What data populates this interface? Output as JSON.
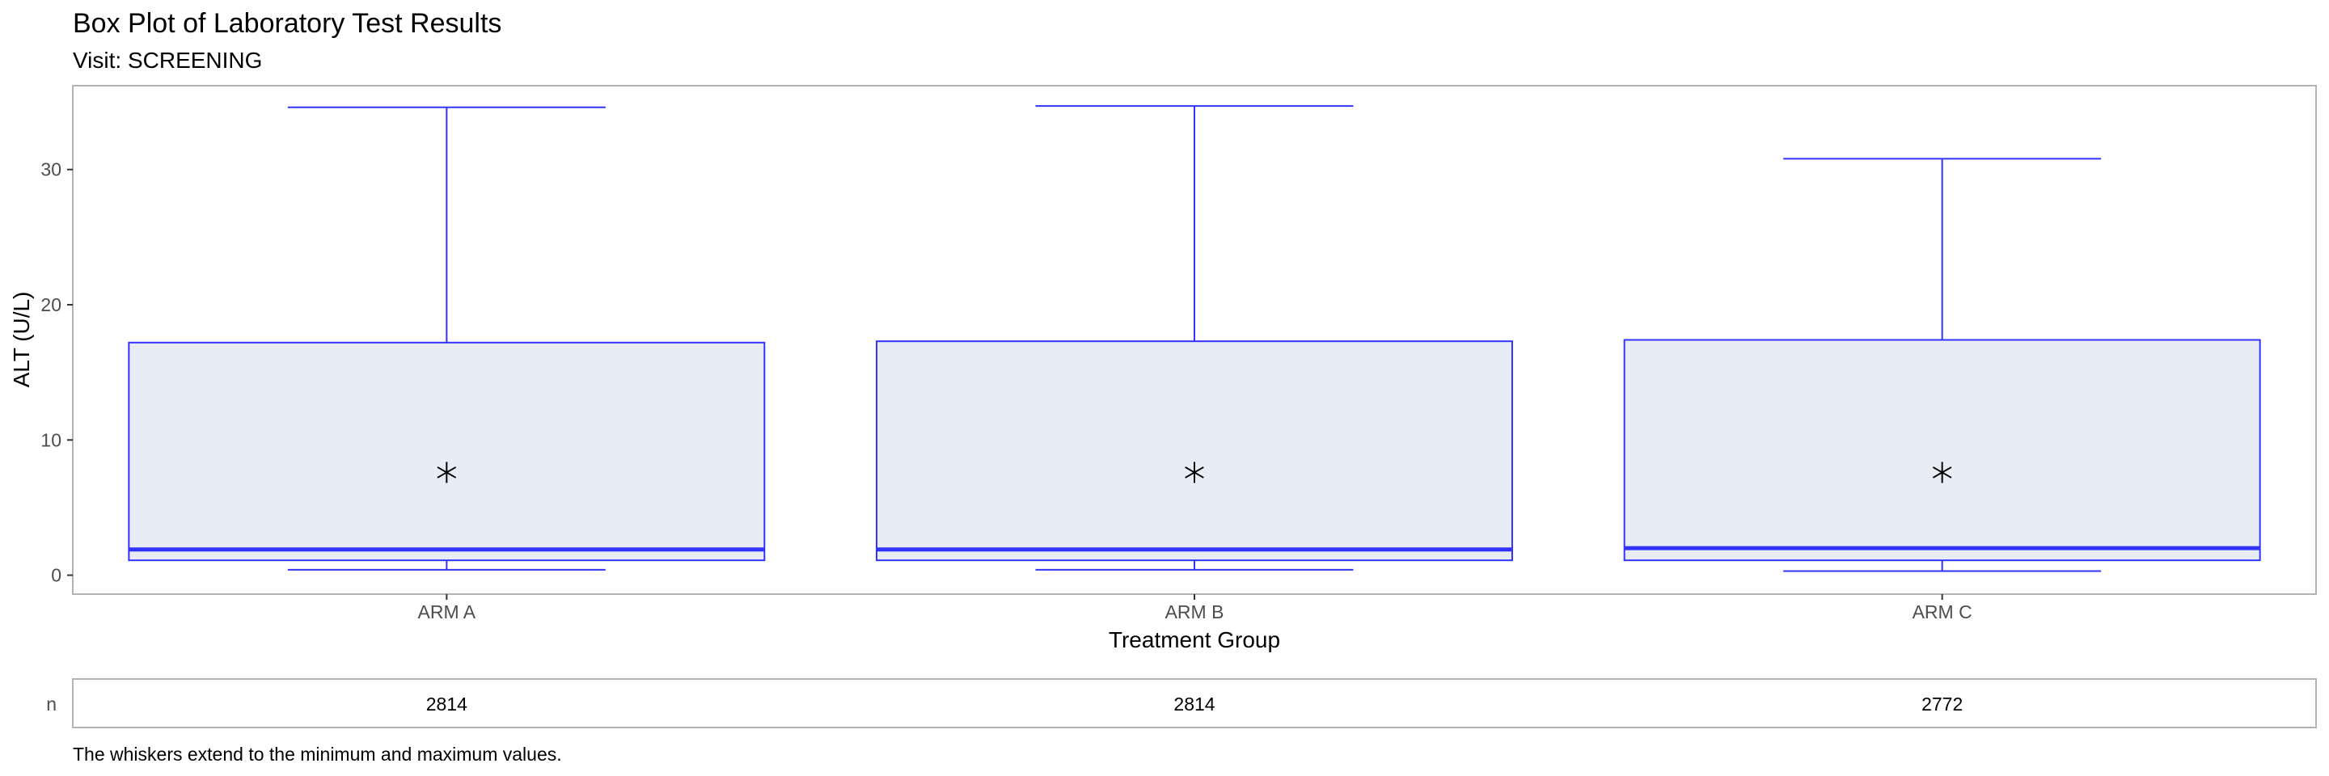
{
  "chart_data": {
    "type": "box",
    "title": "Box Plot of Laboratory Test Results",
    "subtitle": "Visit: SCREENING",
    "xlabel": "Treatment Group",
    "ylabel": "ALT (U/L)",
    "ylim": [
      -1.4,
      36.2
    ],
    "yticks": [
      "0",
      "10",
      "20",
      "30"
    ],
    "categories": [
      "ARM A",
      "ARM B",
      "ARM C"
    ],
    "boxes": [
      {
        "category": "ARM A",
        "min": 0.4,
        "q1": 1.1,
        "median": 1.9,
        "q3": 17.2,
        "max": 34.6,
        "mean": 7.6
      },
      {
        "category": "ARM B",
        "min": 0.4,
        "q1": 1.1,
        "median": 1.9,
        "q3": 17.3,
        "max": 34.7,
        "mean": 7.6
      },
      {
        "category": "ARM C",
        "min": 0.3,
        "q1": 1.1,
        "median": 2.0,
        "q3": 17.4,
        "max": 30.8,
        "mean": 7.6
      }
    ],
    "n_table": {
      "label": "n",
      "values": [
        "2814",
        "2814",
        "2772"
      ]
    },
    "footnote": "The whiskers extend to the minimum and maximum values.",
    "colors": {
      "box_border": "#3333ff",
      "box_fill": "#e8ecf4",
      "mean_marker": "#000000",
      "panel_border": "#b3b3b3"
    },
    "mean_marker": "asterisk",
    "grid": false,
    "legend": "none"
  }
}
